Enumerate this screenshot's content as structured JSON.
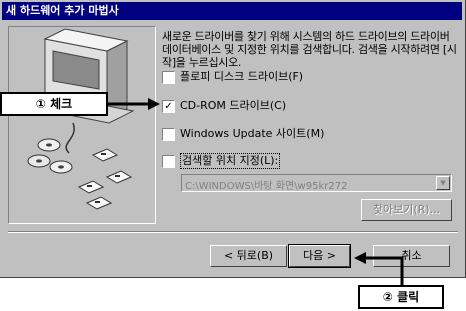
{
  "window": {
    "title": "새 하드웨어 추가 마법사"
  },
  "description": "새로운 드라이버를 찾기 위해 시스템의 하드 드라이브의 드라이버 데이터베이스 및 지정한 위치를 검색합니다. 검색을 시작하려면 [시작]을 누르십시오.",
  "options": [
    {
      "label": "플로피 디스크 드라이브(F)",
      "checked": false,
      "mark": ""
    },
    {
      "label": "CD-ROM 드라이브(C)",
      "checked": true,
      "mark": "✓"
    },
    {
      "label": "Windows Update 사이트(M)",
      "checked": false,
      "mark": ""
    },
    {
      "label": "검색할 위치 지정(L):",
      "checked": false,
      "mark": ""
    }
  ],
  "location": {
    "value": "C:\\WINDOWS\\바탕 화면\\w95kr272"
  },
  "browse_label": "찾아보기(R)...",
  "buttons": {
    "back": "< 뒤로(B)",
    "next": "다음 >",
    "cancel": "취소"
  },
  "annotations": {
    "check": "① 체크",
    "click": "② 클릭"
  },
  "colors": {
    "titlebar": "#000080",
    "face": "#c0c0c0"
  }
}
